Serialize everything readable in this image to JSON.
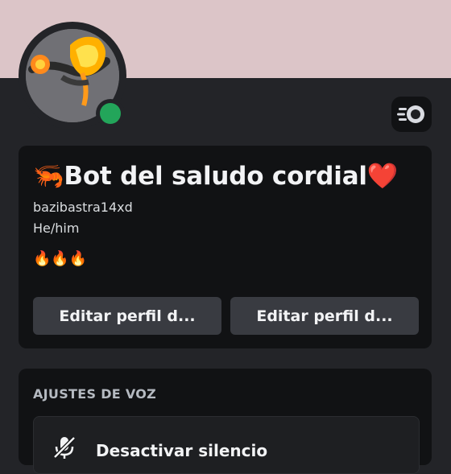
{
  "profile": {
    "display_name": "🦐Bot del saludo cordial❤️",
    "username": "bazibastra14xd",
    "pronouns": "He/him",
    "bio": "🔥🔥🔥",
    "status": "online",
    "avatar_icon": "phoenix-avatar-icon"
  },
  "actions": {
    "edit_profile_1": "Editar perfil d...",
    "edit_profile_2": "Editar perfil d..."
  },
  "voice": {
    "section_title": "AJUSTES DE VOZ",
    "unmute_label": "Desactivar silencio"
  },
  "colors": {
    "banner": "#dcc5c8",
    "status_online": "#23a55a",
    "background": "#232428",
    "card": "#111214"
  }
}
